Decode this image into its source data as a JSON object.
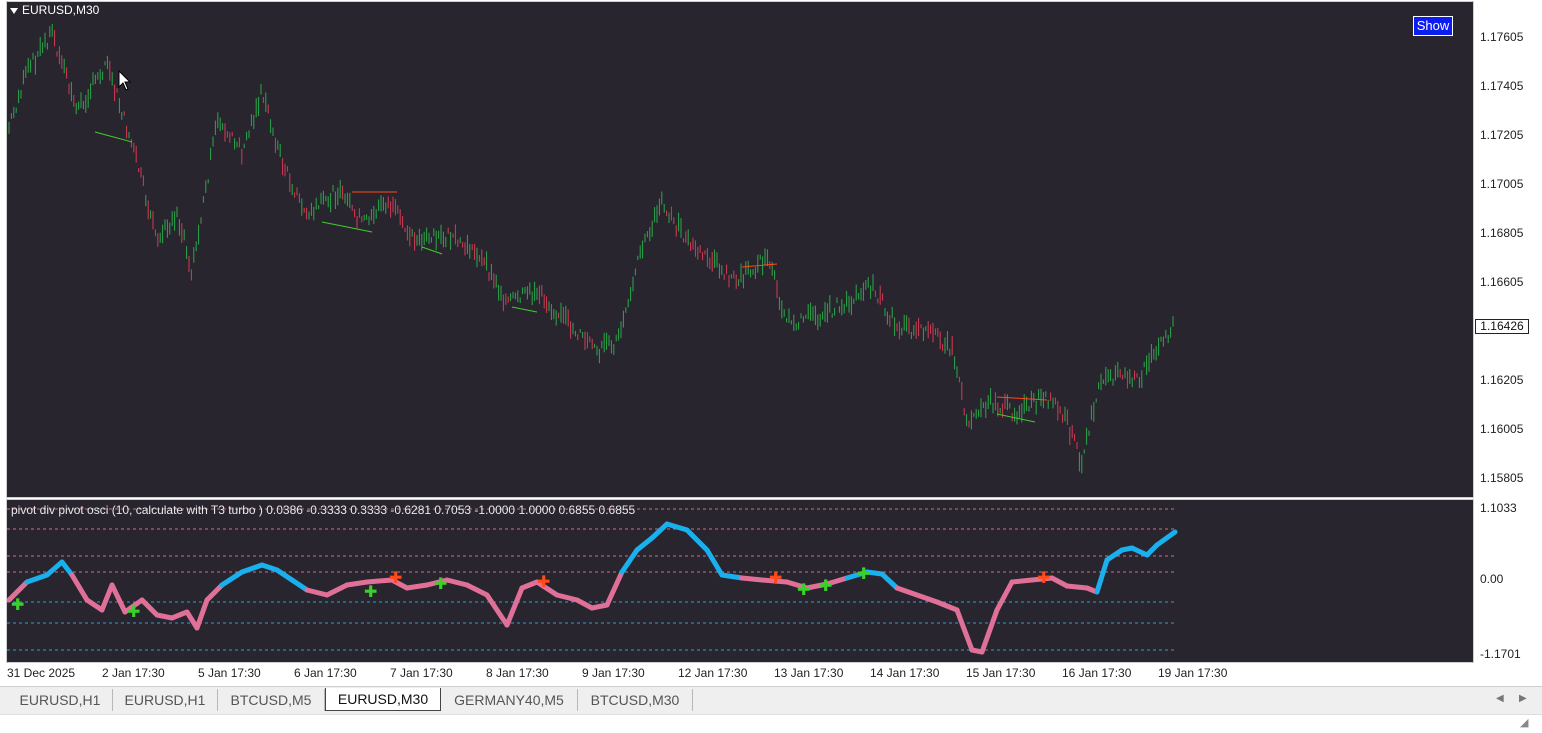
{
  "chart": {
    "symbol_title": "EURUSD,M30",
    "show_button": "Show",
    "current_price": "1.16426",
    "price_axis": [
      "1.17605",
      "1.17405",
      "1.17205",
      "1.17005",
      "1.16805",
      "1.16605",
      "1.16205",
      "1.16005",
      "1.15805"
    ],
    "indicator_label": "pivot div pivot osci (10, calculate with T3 turbo ) 0.0386 -0.3333 0.3333 -0.6281 0.7053 -1.0000 1.0000 0.6855 0.6855",
    "indicator_axis": [
      "1.1033",
      "0.00",
      "-1.1701"
    ],
    "time_axis": [
      "31 Dec 2025",
      "2 Jan 17:30",
      "5 Jan 17:30",
      "6 Jan 17:30",
      "7 Jan 17:30",
      "8 Jan 17:30",
      "9 Jan 17:30",
      "12 Jan 17:30",
      "13 Jan 17:30",
      "14 Jan 17:30",
      "15 Jan 17:30",
      "16 Jan 17:30",
      "19 Jan 17:30"
    ]
  },
  "tabs": [
    {
      "label": "EURUSD,H1",
      "active": false
    },
    {
      "label": "EURUSD,H1",
      "active": false
    },
    {
      "label": "BTCUSD,M5",
      "active": false
    },
    {
      "label": "EURUSD,M30",
      "active": true
    },
    {
      "label": "GERMANY40,M5",
      "active": false
    },
    {
      "label": "BTCUSD,M30",
      "active": false
    }
  ],
  "colors": {
    "background": "#29252e",
    "bull_bar": "#2aa84a",
    "bear_bar": "#d23c55",
    "osc_up": "#1ab0ee",
    "osc_down": "#e07098",
    "buy_arrow": "#3bd12a",
    "sell_arrow": "#ff4a1a"
  }
}
